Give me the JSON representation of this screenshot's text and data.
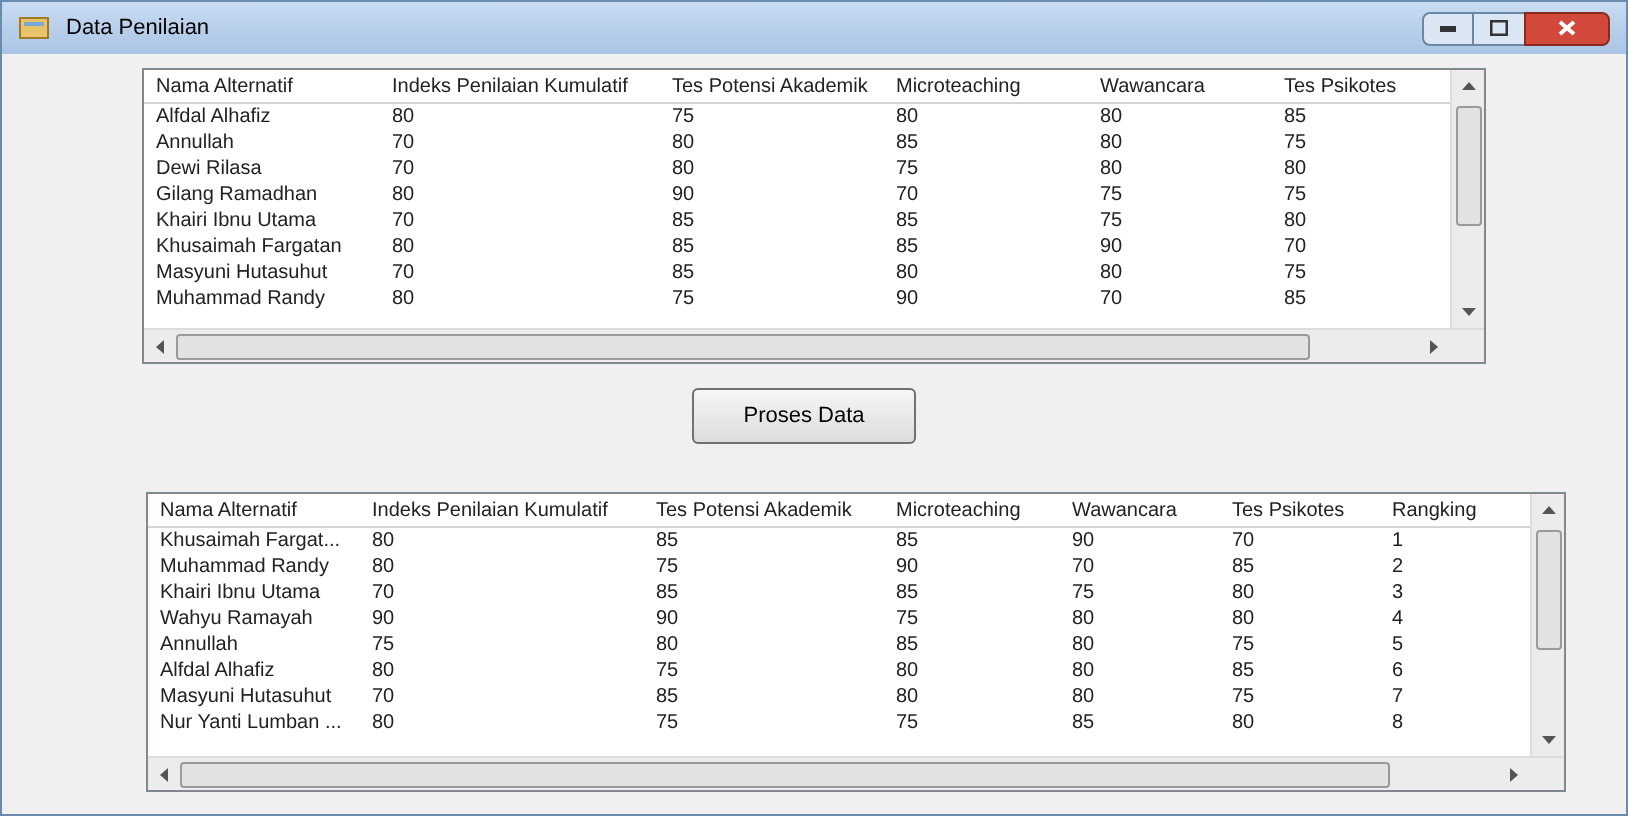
{
  "window": {
    "title": "Data Penilaian"
  },
  "top_table": {
    "columns": [
      "Nama Alternatif",
      "Indeks Penilaian Kumulatif",
      "Tes Potensi Akademik",
      "Microteaching",
      "Wawancara",
      "Tes Psikotes"
    ],
    "rows": [
      [
        "Alfdal Alhafiz",
        "80",
        "75",
        "80",
        "80",
        "85"
      ],
      [
        "Annullah",
        "70",
        "80",
        "85",
        "80",
        "75"
      ],
      [
        "Dewi Rilasa",
        "70",
        "80",
        "75",
        "80",
        "80"
      ],
      [
        "Gilang Ramadhan",
        "80",
        "90",
        "70",
        "75",
        "75"
      ],
      [
        "Khairi Ibnu Utama",
        "70",
        "85",
        "85",
        "75",
        "80"
      ],
      [
        "Khusaimah Fargatan",
        "80",
        "85",
        "85",
        "90",
        "70"
      ],
      [
        "Masyuni Hutasuhut",
        "70",
        "85",
        "80",
        "80",
        "75"
      ],
      [
        "Muhammad Randy",
        "80",
        "75",
        "90",
        "70",
        "85"
      ]
    ]
  },
  "process_button": {
    "label": "Proses Data"
  },
  "bottom_table": {
    "columns": [
      "Nama Alternatif",
      "Indeks Penilaian Kumulatif",
      "Tes Potensi Akademik",
      "Microteaching",
      "Wawancara",
      "Tes Psikotes",
      "Rangking"
    ],
    "rows": [
      [
        "Khusaimah Fargat...",
        "80",
        "85",
        "85",
        "90",
        "70",
        "1"
      ],
      [
        "Muhammad Randy",
        "80",
        "75",
        "90",
        "70",
        "85",
        "2"
      ],
      [
        "Khairi Ibnu Utama",
        "70",
        "85",
        "85",
        "75",
        "80",
        "3"
      ],
      [
        "Wahyu Ramayah",
        "90",
        "90",
        "75",
        "80",
        "80",
        "4"
      ],
      [
        "Annullah",
        "75",
        "80",
        "85",
        "80",
        "75",
        "5"
      ],
      [
        "Alfdal Alhafiz",
        "80",
        "75",
        "80",
        "80",
        "85",
        "6"
      ],
      [
        "Masyuni Hutasuhut",
        "70",
        "85",
        "80",
        "80",
        "75",
        "7"
      ],
      [
        "Nur Yanti Lumban ...",
        "80",
        "75",
        "75",
        "85",
        "80",
        "8"
      ]
    ]
  }
}
